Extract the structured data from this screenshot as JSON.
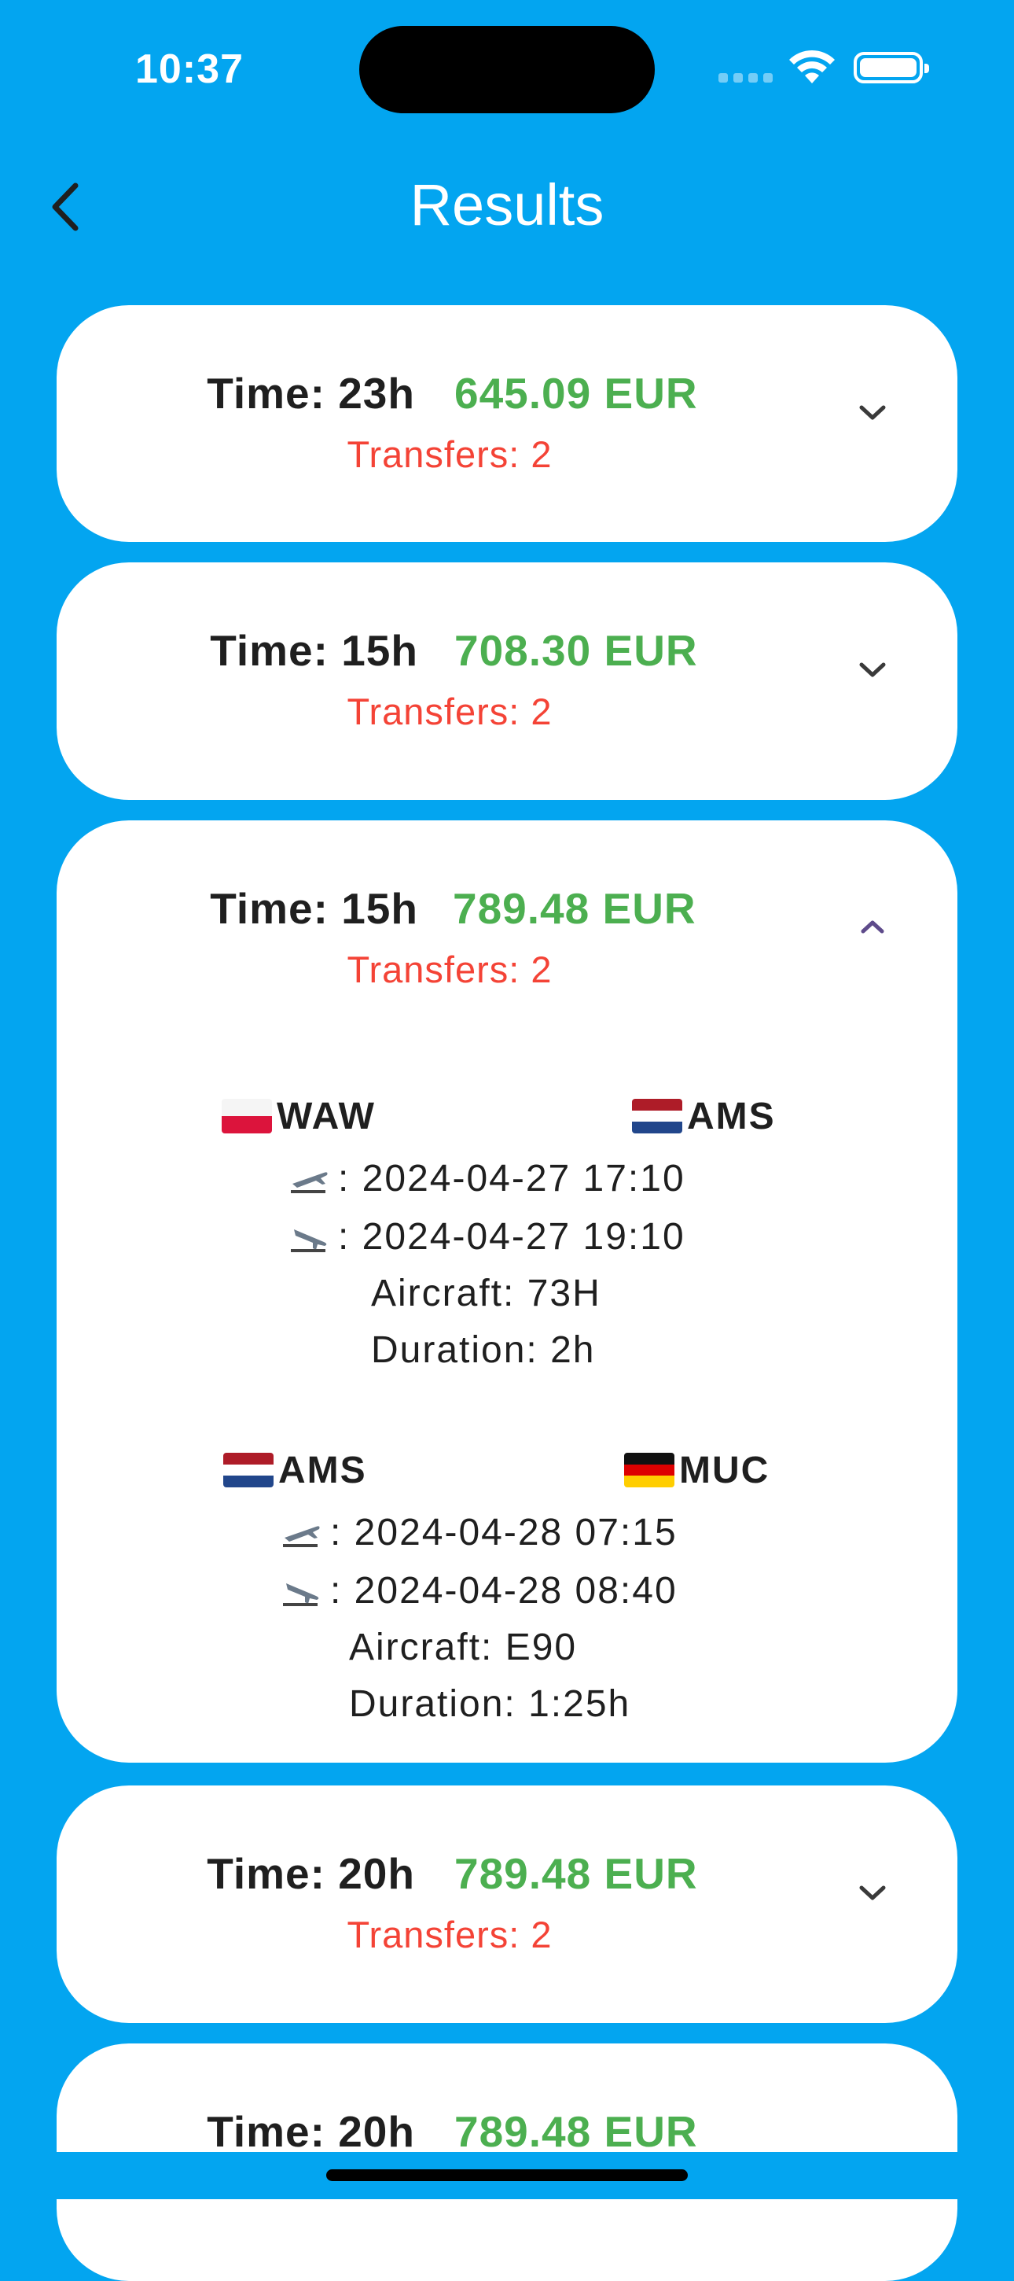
{
  "status": {
    "time": "10:37"
  },
  "nav": {
    "title": "Results"
  },
  "results": [
    {
      "time": "Time: 23h",
      "price": "645.09 EUR",
      "transfers": "Transfers: 2",
      "expanded": false
    },
    {
      "time": "Time: 15h",
      "price": "708.30 EUR",
      "transfers": "Transfers: 2",
      "expanded": false
    },
    {
      "time": "Time: 15h",
      "price": "789.48 EUR",
      "transfers": "Transfers: 2",
      "expanded": true,
      "segments": [
        {
          "from": "WAW",
          "from_flag": "poland-flag",
          "to": "AMS",
          "to_flag": "netherlands-flag",
          "departure": ": 2024-04-27 17:10",
          "arrival": ": 2024-04-27 19:10",
          "aircraft": "Aircraft: 73H",
          "duration": "Duration: 2h"
        },
        {
          "from": "AMS",
          "from_flag": "netherlands-flag",
          "to": "MUC",
          "to_flag": "germany-flag",
          "departure": ": 2024-04-28 07:15",
          "arrival": ": 2024-04-28 08:40",
          "aircraft": "Aircraft: E90",
          "duration": "Duration: 1:25h"
        }
      ]
    },
    {
      "time": "Time: 20h",
      "price": "789.48 EUR",
      "transfers": "Transfers: 2",
      "expanded": false
    },
    {
      "time": "Time: 20h",
      "price": "789.48 EUR",
      "transfers": "",
      "expanded": false
    }
  ],
  "colors": {
    "background": "#03A5F0",
    "price": "#4CAF50",
    "transfers": "#F44336",
    "chevron_active": "#5E4B8B"
  },
  "icons": {
    "back": "back-chevron-icon",
    "expand": "chevron-down-icon",
    "collapse": "chevron-up-icon",
    "takeoff": "plane-takeoff-icon",
    "landing": "plane-landing-icon"
  }
}
